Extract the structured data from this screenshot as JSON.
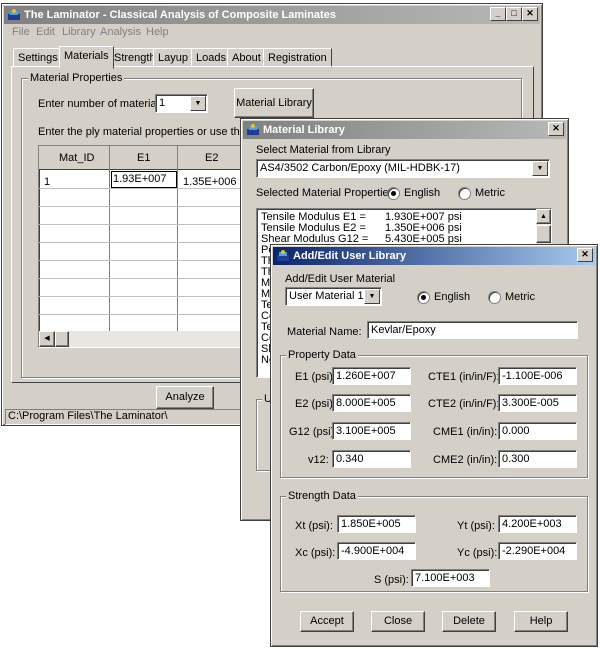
{
  "main_window": {
    "title": "The Laminator - Classical Analysis of Composite Laminates",
    "menu": [
      "File",
      "Edit",
      "Library",
      "Analysis",
      "Help"
    ],
    "tabs": [
      "Settings",
      "Materials",
      "Strength",
      "Layup",
      "Loads",
      "About",
      "Registration"
    ],
    "group_label": "Material Properties",
    "num_materials_label": "Enter number of materials:",
    "num_materials_value": "1",
    "library_button": "Material Library",
    "instruction": "Enter the ply material properties or use the Materia",
    "grid": {
      "headers": [
        "Mat_ID",
        "E1",
        "E2"
      ],
      "row1": [
        "1",
        "1.93E+007",
        "1.35E+006"
      ]
    },
    "analyze_button": "Analyze",
    "status_path": "C:\\Program Files\\The Laminator\\"
  },
  "library_window": {
    "title": "Material Library",
    "select_label": "Select Material from Library",
    "selected_material": "AS4/3502 Carbon/Epoxy (MIL-HDBK-17)",
    "props_label": "Selected Material Properties",
    "english_label": "English",
    "metric_label": "Metric",
    "props_list": [
      {
        "name": "Tensile Modulus E1 =",
        "value": "1.930E+007 psi"
      },
      {
        "name": "Tensile Modulus E2 =",
        "value": "1.350E+006 psi"
      },
      {
        "name": "Shear Modulus G12 =",
        "value": "5.430E+005 psi"
      },
      {
        "name": "Po",
        "value": ""
      },
      {
        "name": "Th",
        "value": ""
      },
      {
        "name": "Th",
        "value": ""
      },
      {
        "name": "Mo",
        "value": ""
      },
      {
        "name": "Mo",
        "value": ""
      },
      {
        "name": "Te",
        "value": ""
      },
      {
        "name": "Co",
        "value": ""
      },
      {
        "name": "Te",
        "value": ""
      },
      {
        "name": "Co",
        "value": ""
      },
      {
        "name": "Sh",
        "value": ""
      },
      {
        "name": "No",
        "value": ""
      }
    ],
    "partial_group_label": "U"
  },
  "user_window": {
    "title": "Add/Edit User Library",
    "section_label": "Add/Edit User Material",
    "user_material": "User Material 1",
    "english_label": "English",
    "metric_label": "Metric",
    "material_name_label": "Material Name:",
    "material_name_value": "Kevlar/Epoxy",
    "property_group_label": "Property Data",
    "properties": {
      "e1_label": "E1 (psi):",
      "e1_value": "1.260E+007",
      "e2_label": "E2 (psi):",
      "e2_value": "8.000E+005",
      "g12_label": "G12 (psi):",
      "g12_value": "3.100E+005",
      "v12_label": "v12:",
      "v12_value": "0.340",
      "cte1_label": "CTE1 (in/in/F):",
      "cte1_value": "-1.100E-006",
      "cte2_label": "CTE2 (in/in/F):",
      "cte2_value": "3.300E-005",
      "cme1_label": "CME1 (in/in):",
      "cme1_value": "0.000",
      "cme2_label": "CME2 (in/in):",
      "cme2_value": "0.300"
    },
    "strength_group_label": "Strength Data",
    "strength": {
      "xt_label": "Xt (psi):",
      "xt_value": "1.850E+005",
      "xc_label": "Xc (psi):",
      "xc_value": "-4.900E+004",
      "yt_label": "Yt (psi):",
      "yt_value": "4.200E+003",
      "yc_label": "Yc (psi):",
      "yc_value": "-2.290E+004",
      "s_label": "S (psi):",
      "s_value": "7.100E+003"
    },
    "buttons": {
      "accept": "Accept",
      "close": "Close",
      "delete": "Delete",
      "help": "Help"
    }
  }
}
